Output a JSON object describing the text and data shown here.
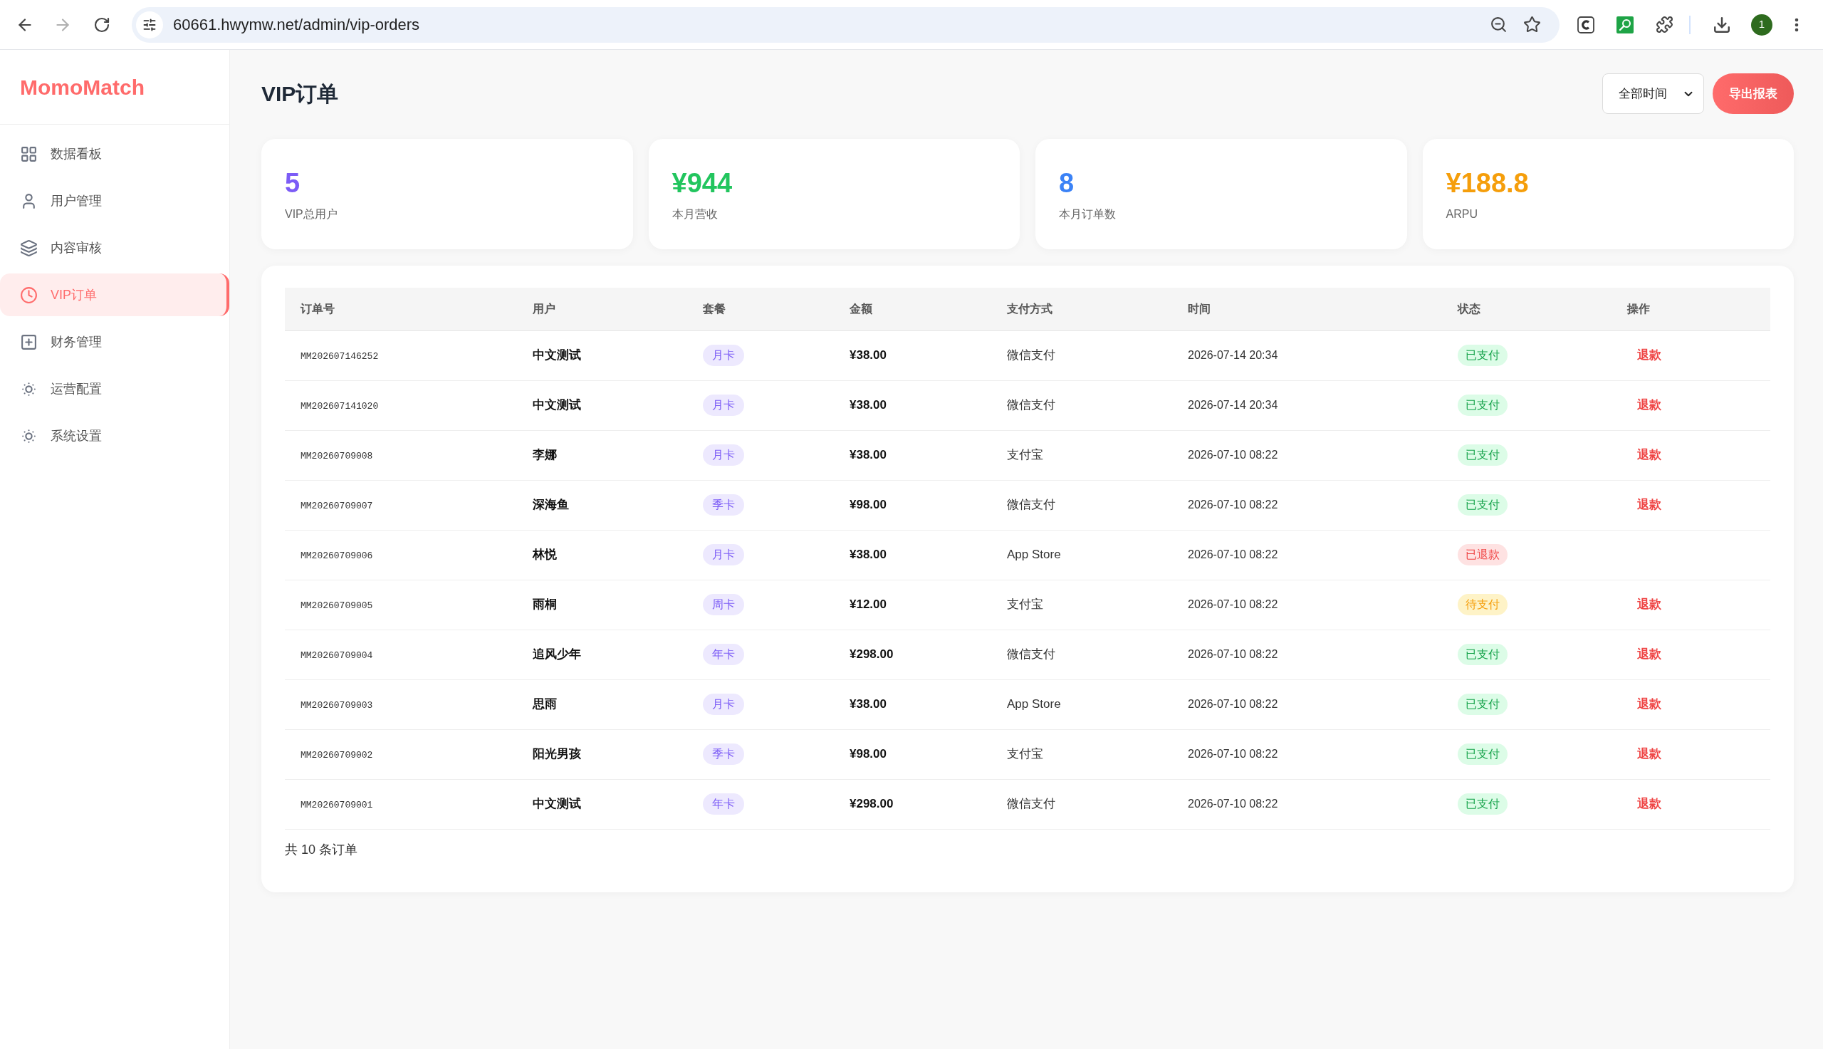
{
  "browser": {
    "url": "60661.hwymw.net/admin/vip-orders",
    "forward_disabled": true,
    "profile_badge": "1"
  },
  "sidebar": {
    "logo": "MomoMatch",
    "items": [
      {
        "label": "数据看板",
        "selected": false
      },
      {
        "label": "用户管理",
        "selected": false
      },
      {
        "label": "内容审核",
        "selected": false
      },
      {
        "label": "VIP订单",
        "selected": true
      },
      {
        "label": "财务管理",
        "selected": false
      },
      {
        "label": "运营配置",
        "selected": false
      },
      {
        "label": "系统设置",
        "selected": false
      }
    ]
  },
  "header": {
    "title": "VIP订单",
    "time_filter": {
      "value": "全部时间"
    },
    "export_button": "导出报表"
  },
  "stats": [
    {
      "value": "5",
      "label": "VIP总用户",
      "color": "#7c5cf6"
    },
    {
      "value": "¥944",
      "label": "本月营收",
      "color": "#22c55e"
    },
    {
      "value": "8",
      "label": "本月订单数",
      "color": "#3b82f6"
    },
    {
      "value": "¥188.8",
      "label": "ARPU",
      "color": "#f59e0b"
    }
  ],
  "table": {
    "columns": [
      "订单号",
      "用户",
      "套餐",
      "金额",
      "支付方式",
      "时间",
      "状态",
      "操作"
    ],
    "rows": [
      {
        "order_no": "MM202607146252",
        "user": "中文测试",
        "plan": "月卡",
        "amount": "¥38.00",
        "payment": "微信支付",
        "time": "2026-07-14 20:34",
        "status": {
          "label": "已支付",
          "kind": "paid"
        },
        "action": "退款"
      },
      {
        "order_no": "MM202607141020",
        "user": "中文测试",
        "plan": "月卡",
        "amount": "¥38.00",
        "payment": "微信支付",
        "time": "2026-07-14 20:34",
        "status": {
          "label": "已支付",
          "kind": "paid"
        },
        "action": "退款"
      },
      {
        "order_no": "MM20260709008",
        "user": "李娜",
        "plan": "月卡",
        "amount": "¥38.00",
        "payment": "支付宝",
        "time": "2026-07-10 08:22",
        "status": {
          "label": "已支付",
          "kind": "paid"
        },
        "action": "退款"
      },
      {
        "order_no": "MM20260709007",
        "user": "深海鱼",
        "plan": "季卡",
        "amount": "¥98.00",
        "payment": "微信支付",
        "time": "2026-07-10 08:22",
        "status": {
          "label": "已支付",
          "kind": "paid"
        },
        "action": "退款"
      },
      {
        "order_no": "MM20260709006",
        "user": "林悦",
        "plan": "月卡",
        "amount": "¥38.00",
        "payment": "App Store",
        "time": "2026-07-10 08:22",
        "status": {
          "label": "已退款",
          "kind": "refunded"
        }
      },
      {
        "order_no": "MM20260709005",
        "user": "雨桐",
        "plan": "周卡",
        "amount": "¥12.00",
        "payment": "支付宝",
        "time": "2026-07-10 08:22",
        "status": {
          "label": "待支付",
          "kind": "pending"
        },
        "action": "退款"
      },
      {
        "order_no": "MM20260709004",
        "user": "追风少年",
        "plan": "年卡",
        "amount": "¥298.00",
        "payment": "微信支付",
        "time": "2026-07-10 08:22",
        "status": {
          "label": "已支付",
          "kind": "paid"
        },
        "action": "退款"
      },
      {
        "order_no": "MM20260709003",
        "user": "思雨",
        "plan": "月卡",
        "amount": "¥38.00",
        "payment": "App Store",
        "time": "2026-07-10 08:22",
        "status": {
          "label": "已支付",
          "kind": "paid"
        },
        "action": "退款"
      },
      {
        "order_no": "MM20260709002",
        "user": "阳光男孩",
        "plan": "季卡",
        "amount": "¥98.00",
        "payment": "支付宝",
        "time": "2026-07-10 08:22",
        "status": {
          "label": "已支付",
          "kind": "paid"
        },
        "action": "退款"
      },
      {
        "order_no": "MM20260709001",
        "user": "中文测试",
        "plan": "年卡",
        "amount": "¥298.00",
        "payment": "微信支付",
        "time": "2026-07-10 08:22",
        "status": {
          "label": "已支付",
          "kind": "paid"
        },
        "action": "退款"
      }
    ],
    "footer": "共 10 条订单"
  }
}
